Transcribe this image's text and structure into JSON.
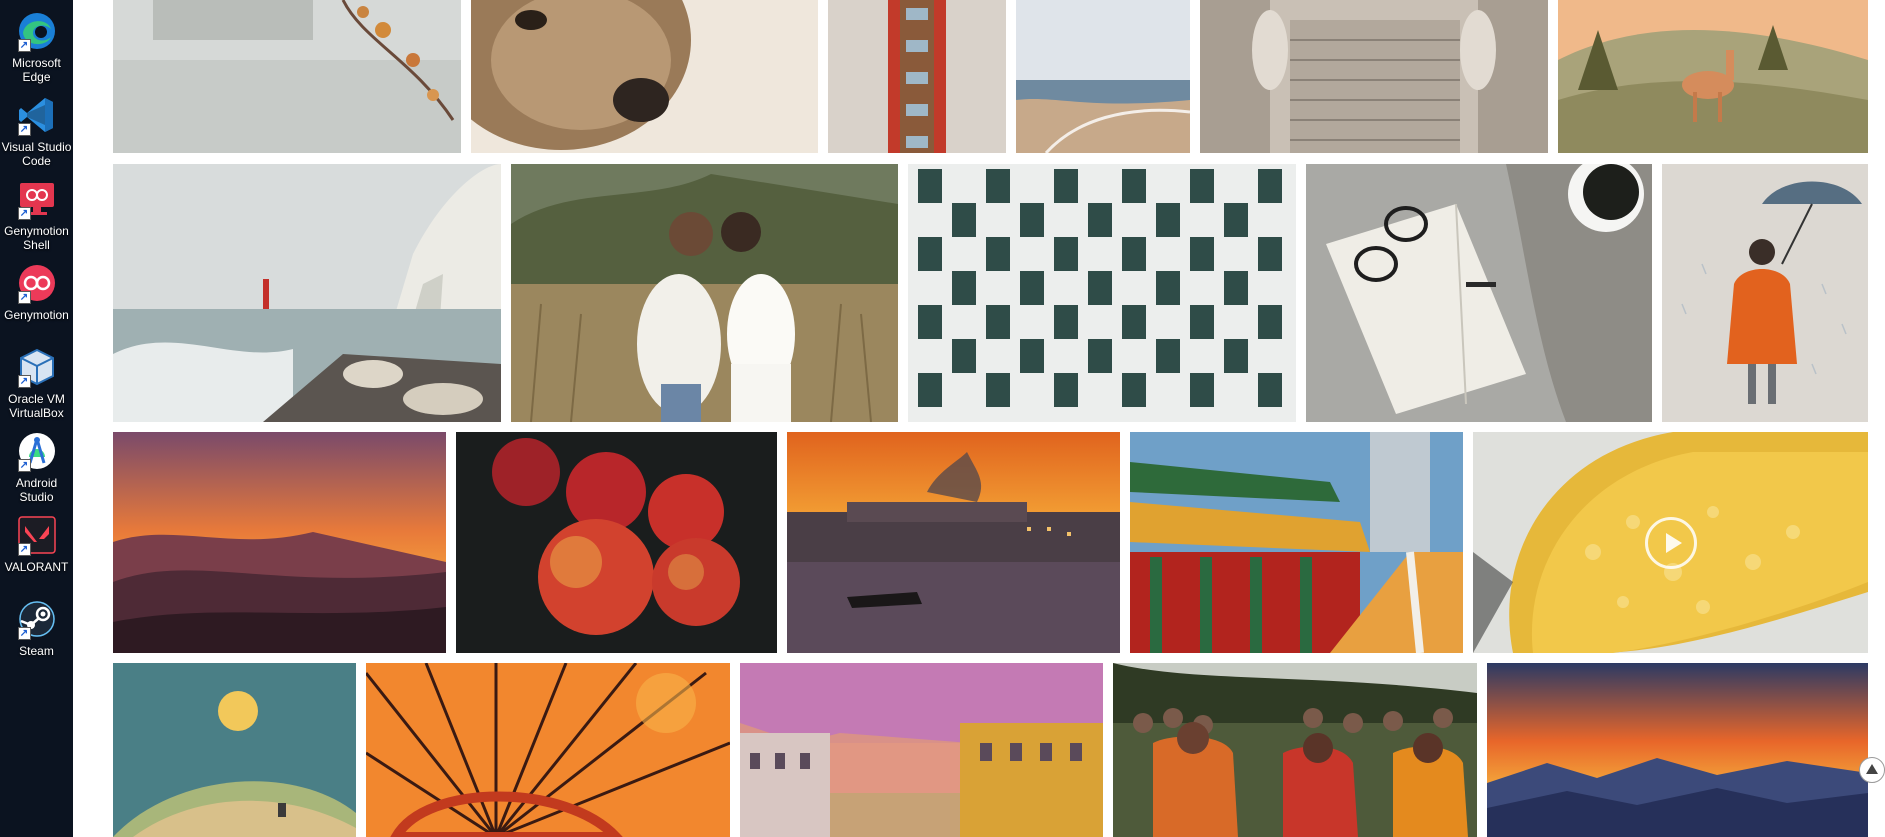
{
  "desktop": {
    "icons": [
      {
        "label": "Microsoft Edge",
        "icon": "edge-icon",
        "color": "#1fa0e3"
      },
      {
        "label": "Visual Studio Code",
        "icon": "vscode-icon",
        "color": "#2b8fe0"
      },
      {
        "label": "Genymotion Shell",
        "icon": "genymotion-shell-icon",
        "color": "#e3364f"
      },
      {
        "label": "Genymotion",
        "icon": "genymotion-icon",
        "color": "#ec3a59"
      },
      {
        "label": "Oracle VM VirtualBox",
        "icon": "virtualbox-icon",
        "color": "#2a70b8"
      },
      {
        "label": "Android Studio",
        "icon": "android-studio-icon",
        "color": "#3ddc84"
      },
      {
        "label": "VALORANT",
        "icon": "valorant-icon",
        "color": "#fa4454"
      },
      {
        "label": "Steam",
        "icon": "steam-icon",
        "color": "#1b2838"
      }
    ]
  },
  "gallery": {
    "photos": [
      {
        "subject": "misty lake with autumn branches"
      },
      {
        "subject": "close-up of terrier dog"
      },
      {
        "subject": "symmetrical building facade"
      },
      {
        "subject": "aerial coastline beach"
      },
      {
        "subject": "grand stone staircase with statues"
      },
      {
        "subject": "illustrated deer in forest"
      },
      {
        "subject": "white cliffs and lighthouse by the sea"
      },
      {
        "subject": "couple kissing in a field"
      },
      {
        "subject": "checkered window building facade"
      },
      {
        "subject": "glasses key notebook and coffee"
      },
      {
        "subject": "illustrated girl with umbrella in rain"
      },
      {
        "subject": "mountain sunset"
      },
      {
        "subject": "red apples"
      },
      {
        "subject": "city waterfront at sunset with boat"
      },
      {
        "subject": "chinese temple"
      },
      {
        "subject": "lemon slice with bubbles",
        "video": true
      },
      {
        "subject": "illustrated moon over hill"
      },
      {
        "subject": "red paper umbrella"
      },
      {
        "subject": "venice canal at sunset"
      },
      {
        "subject": "women in saris at festival"
      },
      {
        "subject": "mountain range sunset"
      }
    ]
  },
  "scroll_top": {
    "icon": "arrow-up-icon"
  }
}
